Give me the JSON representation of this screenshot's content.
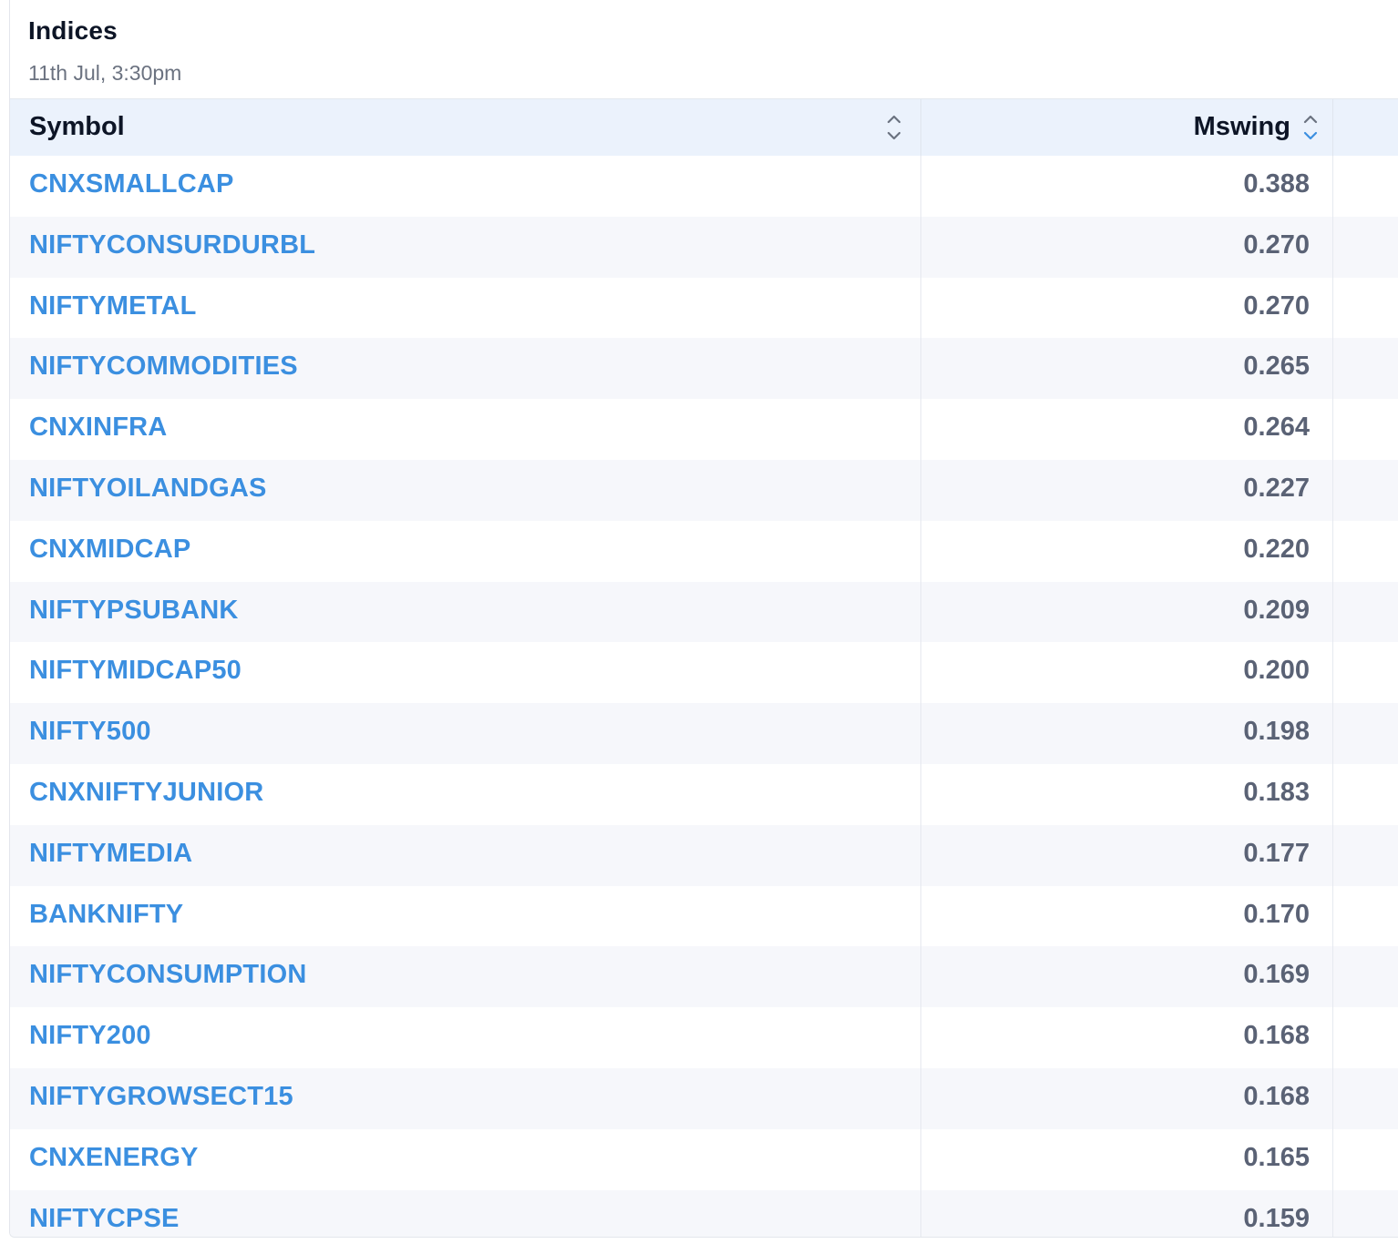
{
  "panel": {
    "title": "Indices",
    "timestamp": "11th Jul, 3:30pm"
  },
  "table": {
    "columns": [
      {
        "key": "symbol",
        "label": "Symbol",
        "sort_icon": "sort-updown-icon"
      },
      {
        "key": "mswing",
        "label": "Mswing",
        "sort_icon": "sort-updown-icon"
      }
    ],
    "rows": [
      {
        "symbol": "CNXSMALLCAP",
        "mswing": "0.388"
      },
      {
        "symbol": "NIFTYCONSURDURBL",
        "mswing": "0.270"
      },
      {
        "symbol": "NIFTYMETAL",
        "mswing": "0.270"
      },
      {
        "symbol": "NIFTYCOMMODITIES",
        "mswing": "0.265"
      },
      {
        "symbol": "CNXINFRA",
        "mswing": "0.264"
      },
      {
        "symbol": "NIFTYOILANDGAS",
        "mswing": "0.227"
      },
      {
        "symbol": "CNXMIDCAP",
        "mswing": "0.220"
      },
      {
        "symbol": "NIFTYPSUBANK",
        "mswing": "0.209"
      },
      {
        "symbol": "NIFTYMIDCAP50",
        "mswing": "0.200"
      },
      {
        "symbol": "NIFTY500",
        "mswing": "0.198"
      },
      {
        "symbol": "CNXNIFTYJUNIOR",
        "mswing": "0.183"
      },
      {
        "symbol": "NIFTYMEDIA",
        "mswing": "0.177"
      },
      {
        "symbol": "BANKNIFTY",
        "mswing": "0.170"
      },
      {
        "symbol": "NIFTYCONSUMPTION",
        "mswing": "0.169"
      },
      {
        "symbol": "NIFTY200",
        "mswing": "0.168"
      },
      {
        "symbol": "NIFTYGROWSECT15",
        "mswing": "0.168"
      },
      {
        "symbol": "CNXENERGY",
        "mswing": "0.165"
      },
      {
        "symbol": "NIFTYCPSE",
        "mswing": "0.159"
      }
    ]
  },
  "colors": {
    "link": "#3b8fe0",
    "header_bg": "#ebf2fc",
    "row_alt_bg": "#f6f7fb",
    "value_text": "#5a6275",
    "sort_active": "#3b8fe0",
    "sort_inactive": "#6b7280"
  }
}
